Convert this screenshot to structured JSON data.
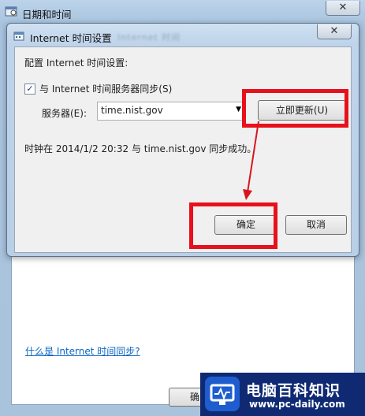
{
  "outer_window": {
    "title": "日期和时间",
    "close_glyph": "✕",
    "help_link": "什么是 Internet 时间同步?",
    "ok_partial": "确"
  },
  "dialog": {
    "title": "Internet 时间设置",
    "ghost_text": "Internet 时间",
    "close_glyph": "✕",
    "config_label": "配置 Internet 时间设置:",
    "sync_checked": true,
    "sync_label": "与 Internet 时间服务器同步(S)",
    "server_label": "服务器(E):",
    "server_value": "time.nist.gov",
    "update_button": "立即更新(U)",
    "status_text": "时钟在 2014/1/2 20:32 与 time.nist.gov 同步成功。",
    "ok_button": "确定",
    "cancel_button": "取消"
  },
  "icons": {
    "window_icon": "date-time-icon",
    "dialog_icon": "internet-time-icon",
    "dropdown": "chevron-down-icon"
  },
  "colors": {
    "highlight": "#e8101c",
    "link": "#0b64c0"
  },
  "watermark": {
    "title": "电脑百科知识",
    "url": "www.pc-daily.com"
  }
}
